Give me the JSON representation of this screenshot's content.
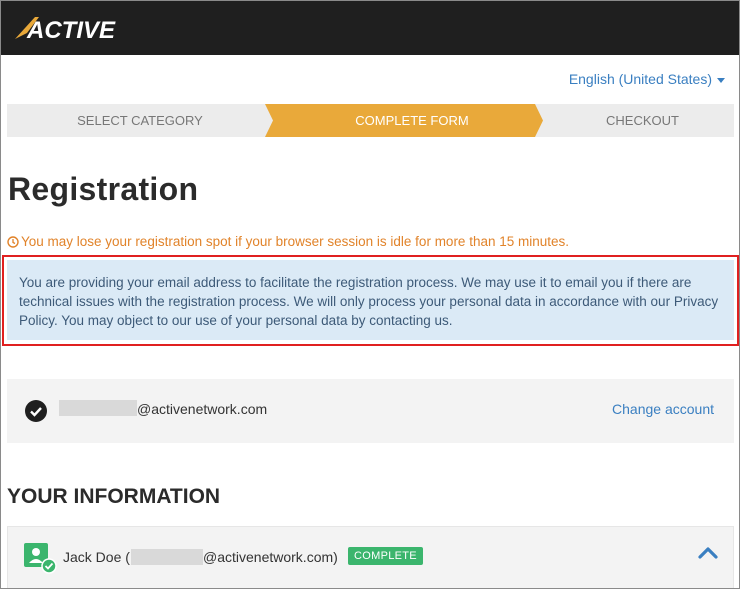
{
  "brand": {
    "logo_text": "ACTIVE"
  },
  "language": {
    "label": "English (United States)"
  },
  "steps": [
    {
      "label": "SELECT CATEGORY",
      "state": "done"
    },
    {
      "label": "COMPLETE FORM",
      "state": "active"
    },
    {
      "label": "CHECKOUT",
      "state": "upcoming"
    }
  ],
  "page": {
    "title": "Registration",
    "idle_warning": "You may lose your registration spot if your browser session is idle for more than 15 minutes.",
    "privacy_notice": "You are providing your email address to facilitate the registration process. We may use it to email you if there are technical issues with the registration process. We will only process your personal data in accordance with our Privacy Policy. You may object to our use of your personal data by contacting us."
  },
  "account": {
    "email_suffix": "@activenetwork.com",
    "change_label": "Change account"
  },
  "your_information": {
    "heading": "YOUR INFORMATION",
    "person_name": "Jack Doe (",
    "person_email_suffix": "@activenetwork.com)",
    "status_badge": "COMPLETE"
  },
  "colors": {
    "topbar": "#1f1f1f",
    "step_active": "#e9a93a",
    "step_inactive": "#ececec",
    "link": "#3a7fc1",
    "warning": "#e1832a",
    "notice_bg": "#dbeaf6",
    "highlight_outline": "#e02020",
    "badge": "#3bb56d"
  }
}
